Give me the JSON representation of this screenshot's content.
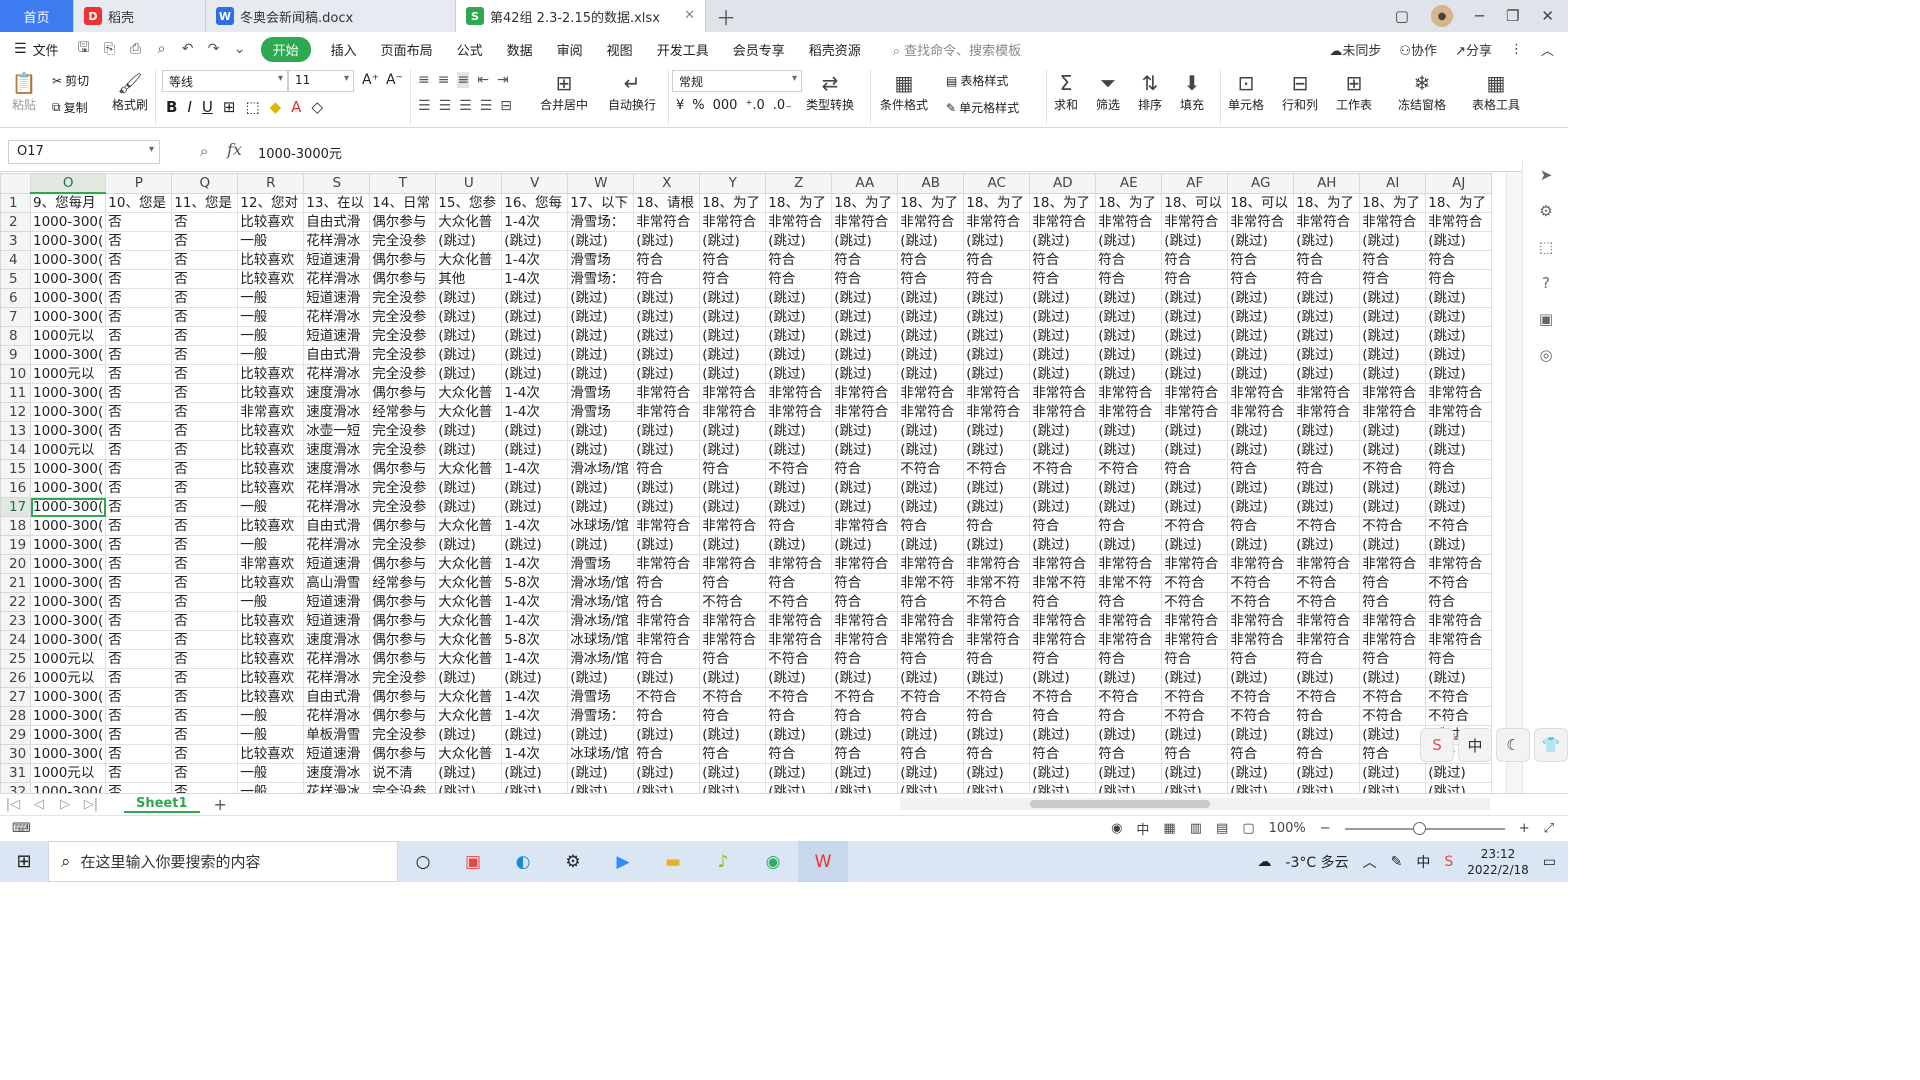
{
  "tabs": {
    "home": "首页",
    "daoke": "稻壳",
    "doc": "冬奥会新闻稿.docx",
    "xlsx": "第42组 2.3-2.15的数据.xlsx"
  },
  "menu": {
    "file": "文件",
    "items": [
      "开始",
      "插入",
      "页面布局",
      "公式",
      "数据",
      "审阅",
      "视图",
      "开发工具",
      "会员专享",
      "稻壳资源"
    ],
    "search": "查找命令、搜索模板",
    "sync": "未同步",
    "collab": "协作",
    "share": "分享"
  },
  "ribbon": {
    "paste": "粘贴",
    "cut": "剪切",
    "copy": "复制",
    "format_painter": "格式刷",
    "font_name": "等线",
    "font_size": "11",
    "merge": "合并居中",
    "wrap": "自动换行",
    "num_format": "常规",
    "type_convert": "类型转换",
    "cond_format": "条件格式",
    "table_style": "表格样式",
    "cell_style": "单元格样式",
    "sum": "求和",
    "filter": "筛选",
    "sort": "排序",
    "fill": "填充",
    "cell": "单元格",
    "rowcol": "行和列",
    "worksheet": "工作表",
    "freeze": "冻结窗格",
    "tools": "表格工具"
  },
  "formula": {
    "cell_ref": "O17",
    "fx": "fx",
    "value": "1000-3000元"
  },
  "grid": {
    "columns": [
      "O",
      "P",
      "Q",
      "R",
      "S",
      "T",
      "U",
      "V",
      "W",
      "X",
      "Y",
      "Z",
      "AA",
      "AB",
      "AC",
      "AD",
      "AE",
      "AF",
      "AG",
      "AH",
      "AI",
      "AJ"
    ],
    "selected_col": "O",
    "selected_row": 17,
    "header_row": [
      "9、您每月",
      "10、您是",
      "11、您是",
      "12、您对",
      "13、在以",
      "14、日常",
      "15、您参",
      "16、您每",
      "17、以下",
      "18、请根",
      "18、为了",
      "18、为了",
      "18、为了",
      "18、为了",
      "18、为了",
      "18、为了",
      "18、为了",
      "18、可以",
      "18、可以",
      "18、为了",
      "18、为了",
      "18、为了"
    ],
    "rows": [
      [
        "1000-300(",
        "否",
        "否",
        "比较喜欢",
        "自由式滑",
        "偶尔参与",
        "大众化普",
        "1-4次",
        "滑雪场：",
        "非常符合",
        "非常符合",
        "非常符合",
        "非常符合",
        "非常符合",
        "非常符合",
        "非常符合",
        "非常符合",
        "非常符合",
        "非常符合",
        "非常符合",
        "非常符合",
        "非常符合"
      ],
      [
        "1000-300(",
        "否",
        "否",
        "一般",
        "花样滑冰",
        "完全没参",
        "(跳过)",
        "(跳过)",
        "(跳过)",
        "(跳过)",
        "(跳过)",
        "(跳过)",
        "(跳过)",
        "(跳过)",
        "(跳过)",
        "(跳过)",
        "(跳过)",
        "(跳过)",
        "(跳过)",
        "(跳过)",
        "(跳过)",
        "(跳过)"
      ],
      [
        "1000-300(",
        "否",
        "否",
        "比较喜欢",
        "短道速滑",
        "偶尔参与",
        "大众化普",
        "1-4次",
        "滑雪场",
        "符合",
        "符合",
        "符合",
        "符合",
        "符合",
        "符合",
        "符合",
        "符合",
        "符合",
        "符合",
        "符合",
        "符合",
        "符合"
      ],
      [
        "1000-300(",
        "否",
        "否",
        "比较喜欢",
        "花样滑冰",
        "偶尔参与",
        "其他",
        "1-4次",
        "滑雪场：",
        "符合",
        "符合",
        "符合",
        "符合",
        "符合",
        "符合",
        "符合",
        "符合",
        "符合",
        "符合",
        "符合",
        "符合",
        "符合"
      ],
      [
        "1000-300(",
        "否",
        "否",
        "一般",
        "短道速滑",
        "完全没参",
        "(跳过)",
        "(跳过)",
        "(跳过)",
        "(跳过)",
        "(跳过)",
        "(跳过)",
        "(跳过)",
        "(跳过)",
        "(跳过)",
        "(跳过)",
        "(跳过)",
        "(跳过)",
        "(跳过)",
        "(跳过)",
        "(跳过)",
        "(跳过)"
      ],
      [
        "1000-300(",
        "否",
        "否",
        "一般",
        "花样滑冰",
        "完全没参",
        "(跳过)",
        "(跳过)",
        "(跳过)",
        "(跳过)",
        "(跳过)",
        "(跳过)",
        "(跳过)",
        "(跳过)",
        "(跳过)",
        "(跳过)",
        "(跳过)",
        "(跳过)",
        "(跳过)",
        "(跳过)",
        "(跳过)",
        "(跳过)"
      ],
      [
        "1000元以",
        "否",
        "否",
        "一般",
        "短道速滑",
        "完全没参",
        "(跳过)",
        "(跳过)",
        "(跳过)",
        "(跳过)",
        "(跳过)",
        "(跳过)",
        "(跳过)",
        "(跳过)",
        "(跳过)",
        "(跳过)",
        "(跳过)",
        "(跳过)",
        "(跳过)",
        "(跳过)",
        "(跳过)",
        "(跳过)"
      ],
      [
        "1000-300(",
        "否",
        "否",
        "一般",
        "自由式滑",
        "完全没参",
        "(跳过)",
        "(跳过)",
        "(跳过)",
        "(跳过)",
        "(跳过)",
        "(跳过)",
        "(跳过)",
        "(跳过)",
        "(跳过)",
        "(跳过)",
        "(跳过)",
        "(跳过)",
        "(跳过)",
        "(跳过)",
        "(跳过)",
        "(跳过)"
      ],
      [
        "1000元以",
        "否",
        "否",
        "比较喜欢",
        "花样滑冰",
        "完全没参",
        "(跳过)",
        "(跳过)",
        "(跳过)",
        "(跳过)",
        "(跳过)",
        "(跳过)",
        "(跳过)",
        "(跳过)",
        "(跳过)",
        "(跳过)",
        "(跳过)",
        "(跳过)",
        "(跳过)",
        "(跳过)",
        "(跳过)",
        "(跳过)"
      ],
      [
        "1000-300(",
        "否",
        "否",
        "比较喜欢",
        "速度滑冰",
        "偶尔参与",
        "大众化普",
        "1-4次",
        "滑雪场",
        "非常符合",
        "非常符合",
        "非常符合",
        "非常符合",
        "非常符合",
        "非常符合",
        "非常符合",
        "非常符合",
        "非常符合",
        "非常符合",
        "非常符合",
        "非常符合",
        "非常符合"
      ],
      [
        "1000-300(",
        "否",
        "否",
        "非常喜欢",
        "速度滑冰",
        "经常参与",
        "大众化普",
        "1-4次",
        "滑雪场",
        "非常符合",
        "非常符合",
        "非常符合",
        "非常符合",
        "非常符合",
        "非常符合",
        "非常符合",
        "非常符合",
        "非常符合",
        "非常符合",
        "非常符合",
        "非常符合",
        "非常符合"
      ],
      [
        "1000-300(",
        "否",
        "否",
        "比较喜欢",
        "冰壶一短",
        "完全没参",
        "(跳过)",
        "(跳过)",
        "(跳过)",
        "(跳过)",
        "(跳过)",
        "(跳过)",
        "(跳过)",
        "(跳过)",
        "(跳过)",
        "(跳过)",
        "(跳过)",
        "(跳过)",
        "(跳过)",
        "(跳过)",
        "(跳过)",
        "(跳过)"
      ],
      [
        "1000元以",
        "否",
        "否",
        "比较喜欢",
        "速度滑冰",
        "完全没参",
        "(跳过)",
        "(跳过)",
        "(跳过)",
        "(跳过)",
        "(跳过)",
        "(跳过)",
        "(跳过)",
        "(跳过)",
        "(跳过)",
        "(跳过)",
        "(跳过)",
        "(跳过)",
        "(跳过)",
        "(跳过)",
        "(跳过)",
        "(跳过)"
      ],
      [
        "1000-300(",
        "否",
        "否",
        "比较喜欢",
        "速度滑冰",
        "偶尔参与",
        "大众化普",
        "1-4次",
        "滑冰场/馆",
        "符合",
        "符合",
        "不符合",
        "符合",
        "不符合",
        "不符合",
        "不符合",
        "不符合",
        "符合",
        "符合",
        "符合",
        "不符合",
        "符合"
      ],
      [
        "1000-300(",
        "否",
        "否",
        "比较喜欢",
        "花样滑冰",
        "完全没参",
        "(跳过)",
        "(跳过)",
        "(跳过)",
        "(跳过)",
        "(跳过)",
        "(跳过)",
        "(跳过)",
        "(跳过)",
        "(跳过)",
        "(跳过)",
        "(跳过)",
        "(跳过)",
        "(跳过)",
        "(跳过)",
        "(跳过)",
        "(跳过)"
      ],
      [
        "1000-300(",
        "否",
        "否",
        "一般",
        "花样滑冰",
        "完全没参",
        "(跳过)",
        "(跳过)",
        "(跳过)",
        "(跳过)",
        "(跳过)",
        "(跳过)",
        "(跳过)",
        "(跳过)",
        "(跳过)",
        "(跳过)",
        "(跳过)",
        "(跳过)",
        "(跳过)",
        "(跳过)",
        "(跳过)",
        "(跳过)"
      ],
      [
        "1000-300(",
        "否",
        "否",
        "比较喜欢",
        "自由式滑",
        "偶尔参与",
        "大众化普",
        "1-4次",
        "冰球场/馆",
        "非常符合",
        "非常符合",
        "符合",
        "非常符合",
        "符合",
        "符合",
        "符合",
        "符合",
        "不符合",
        "符合",
        "不符合",
        "不符合",
        "不符合"
      ],
      [
        "1000-300(",
        "否",
        "否",
        "一般",
        "花样滑冰",
        "完全没参",
        "(跳过)",
        "(跳过)",
        "(跳过)",
        "(跳过)",
        "(跳过)",
        "(跳过)",
        "(跳过)",
        "(跳过)",
        "(跳过)",
        "(跳过)",
        "(跳过)",
        "(跳过)",
        "(跳过)",
        "(跳过)",
        "(跳过)",
        "(跳过)"
      ],
      [
        "1000-300(",
        "否",
        "否",
        "非常喜欢",
        "短道速滑",
        "偶尔参与",
        "大众化普",
        "1-4次",
        "滑雪场",
        "非常符合",
        "非常符合",
        "非常符合",
        "非常符合",
        "非常符合",
        "非常符合",
        "非常符合",
        "非常符合",
        "非常符合",
        "非常符合",
        "非常符合",
        "非常符合",
        "非常符合"
      ],
      [
        "1000-300(",
        "否",
        "否",
        "比较喜欢",
        "高山滑雪",
        "经常参与",
        "大众化普",
        "5-8次",
        "滑冰场/馆",
        "符合",
        "符合",
        "符合",
        "符合",
        "非常不符",
        "非常不符",
        "非常不符",
        "非常不符",
        "不符合",
        "不符合",
        "不符合",
        "符合",
        "不符合"
      ],
      [
        "1000-300(",
        "否",
        "否",
        "一般",
        "短道速滑",
        "偶尔参与",
        "大众化普",
        "1-4次",
        "滑冰场/馆",
        "符合",
        "不符合",
        "不符合",
        "符合",
        "符合",
        "不符合",
        "符合",
        "符合",
        "不符合",
        "不符合",
        "不符合",
        "符合",
        "符合"
      ],
      [
        "1000-300(",
        "否",
        "否",
        "比较喜欢",
        "短道速滑",
        "偶尔参与",
        "大众化普",
        "1-4次",
        "滑冰场/馆",
        "非常符合",
        "非常符合",
        "非常符合",
        "非常符合",
        "非常符合",
        "非常符合",
        "非常符合",
        "非常符合",
        "非常符合",
        "非常符合",
        "非常符合",
        "非常符合",
        "非常符合"
      ],
      [
        "1000-300(",
        "否",
        "否",
        "比较喜欢",
        "速度滑冰",
        "偶尔参与",
        "大众化普",
        "5-8次",
        "冰球场/馆",
        "非常符合",
        "非常符合",
        "非常符合",
        "非常符合",
        "非常符合",
        "非常符合",
        "非常符合",
        "非常符合",
        "非常符合",
        "非常符合",
        "非常符合",
        "非常符合",
        "非常符合"
      ],
      [
        "1000元以",
        "否",
        "否",
        "比较喜欢",
        "花样滑冰",
        "偶尔参与",
        "大众化普",
        "1-4次",
        "滑冰场/馆",
        "符合",
        "符合",
        "不符合",
        "符合",
        "符合",
        "符合",
        "符合",
        "符合",
        "符合",
        "符合",
        "符合",
        "符合",
        "符合"
      ],
      [
        "1000元以",
        "否",
        "否",
        "比较喜欢",
        "花样滑冰",
        "完全没参",
        "(跳过)",
        "(跳过)",
        "(跳过)",
        "(跳过)",
        "(跳过)",
        "(跳过)",
        "(跳过)",
        "(跳过)",
        "(跳过)",
        "(跳过)",
        "(跳过)",
        "(跳过)",
        "(跳过)",
        "(跳过)",
        "(跳过)",
        "(跳过)"
      ],
      [
        "1000-300(",
        "否",
        "否",
        "比较喜欢",
        "自由式滑",
        "偶尔参与",
        "大众化普",
        "1-4次",
        "滑雪场",
        "不符合",
        "不符合",
        "不符合",
        "不符合",
        "不符合",
        "不符合",
        "不符合",
        "不符合",
        "不符合",
        "不符合",
        "不符合",
        "不符合",
        "不符合"
      ],
      [
        "1000-300(",
        "否",
        "否",
        "一般",
        "花样滑冰",
        "偶尔参与",
        "大众化普",
        "1-4次",
        "滑雪场：",
        "符合",
        "符合",
        "符合",
        "符合",
        "符合",
        "符合",
        "符合",
        "符合",
        "不符合",
        "不符合",
        "符合",
        "不符合",
        "不符合"
      ],
      [
        "1000-300(",
        "否",
        "否",
        "一般",
        "单板滑雪",
        "完全没参",
        "(跳过)",
        "(跳过)",
        "(跳过)",
        "(跳过)",
        "(跳过)",
        "(跳过)",
        "(跳过)",
        "(跳过)",
        "(跳过)",
        "(跳过)",
        "(跳过)",
        "(跳过)",
        "(跳过)",
        "(跳过)",
        "(跳过)",
        "(跳过)"
      ],
      [
        "1000-300(",
        "否",
        "否",
        "比较喜欢",
        "短道速滑",
        "偶尔参与",
        "大众化普",
        "1-4次",
        "冰球场/馆",
        "符合",
        "符合",
        "符合",
        "符合",
        "符合",
        "符合",
        "符合",
        "符合",
        "符合",
        "符合",
        "符合",
        "符合",
        "符合"
      ],
      [
        "1000元以",
        "否",
        "否",
        "一般",
        "速度滑冰",
        "说不清",
        "(跳过)",
        "(跳过)",
        "(跳过)",
        "(跳过)",
        "(跳过)",
        "(跳过)",
        "(跳过)",
        "(跳过)",
        "(跳过)",
        "(跳过)",
        "(跳过)",
        "(跳过)",
        "(跳过)",
        "(跳过)",
        "(跳过)",
        "(跳过)"
      ],
      [
        "1000-300(",
        "否",
        "否",
        "一般",
        "花样滑冰",
        "完全没参",
        "(跳过)",
        "(跳过)",
        "(跳过)",
        "(跳过)",
        "(跳过)",
        "(跳过)",
        "(跳过)",
        "(跳过)",
        "(跳过)",
        "(跳过)",
        "(跳过)",
        "(跳过)",
        "(跳过)",
        "(跳过)",
        "(跳过)",
        "(跳过)"
      ]
    ]
  },
  "sheet": {
    "name": "Sheet1"
  },
  "status": {
    "zoom": "100%"
  },
  "ime": [
    "中"
  ],
  "taskbar": {
    "search": "在这里输入你要搜索的内容",
    "weather": "-3°C  多云",
    "time": "23:12",
    "date": "2022/2/18",
    "lang": "中"
  }
}
